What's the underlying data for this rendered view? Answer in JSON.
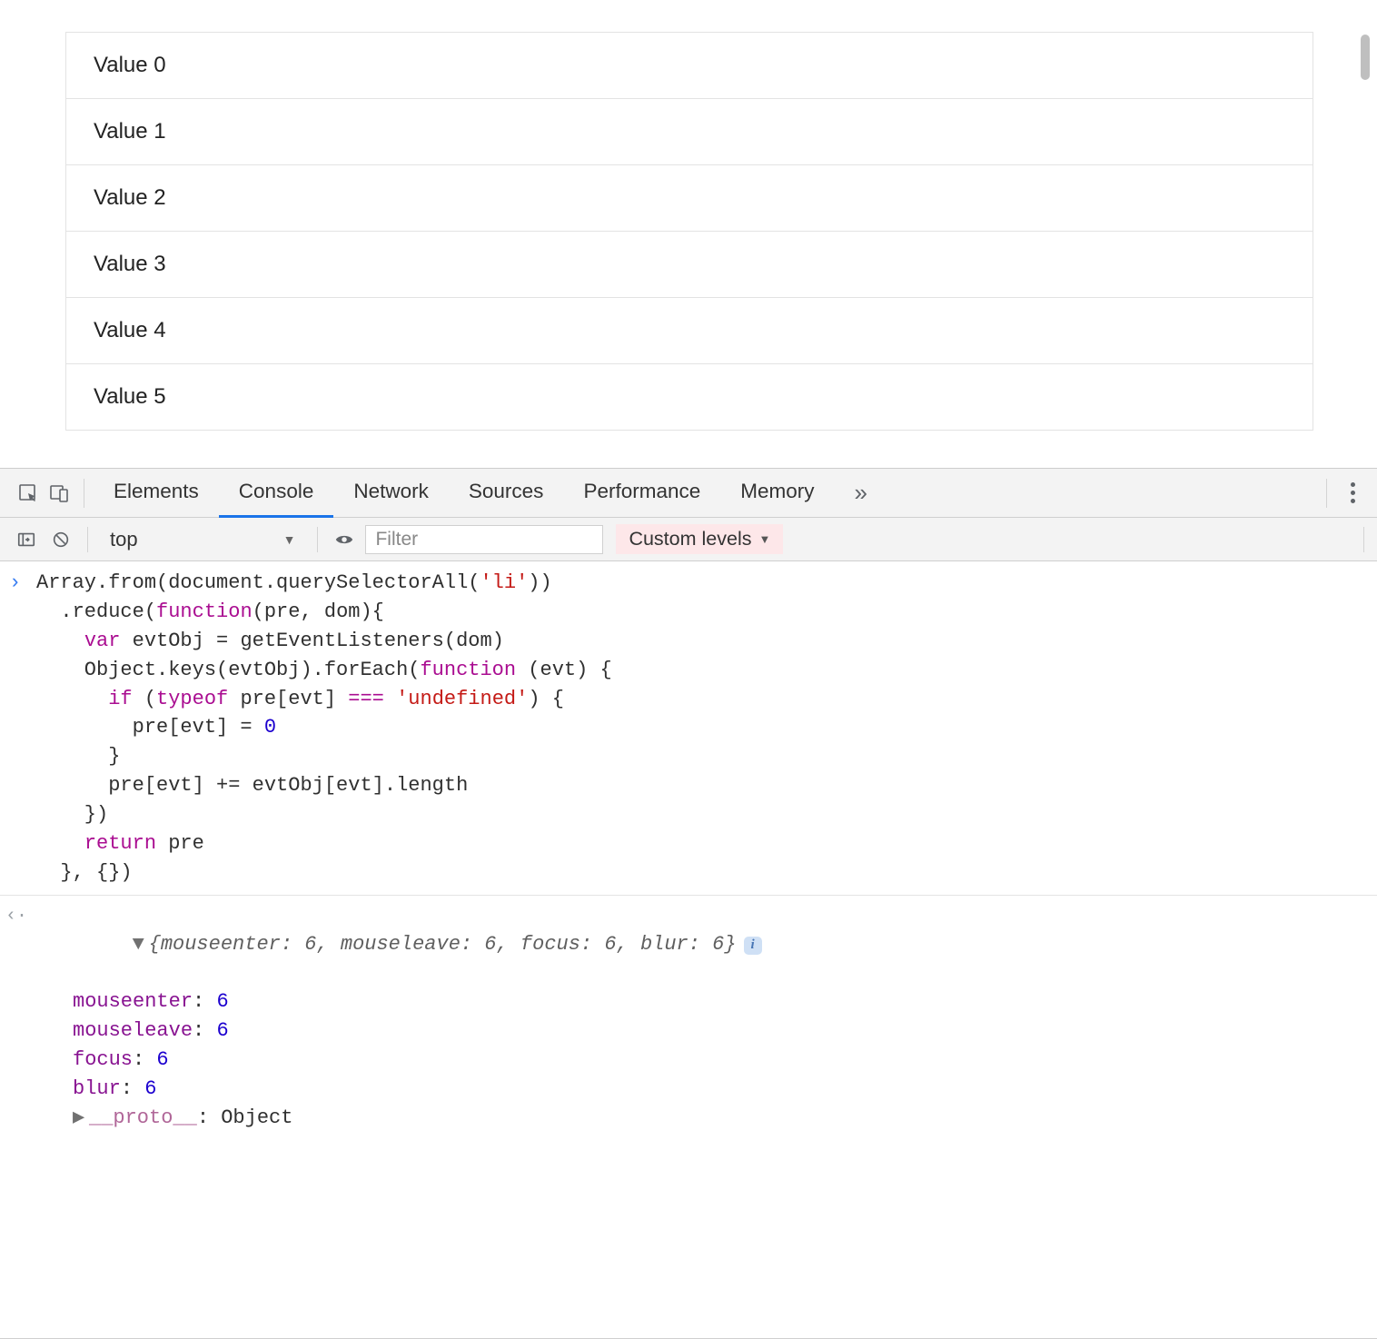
{
  "page": {
    "list_items": [
      "Value 0",
      "Value 1",
      "Value 2",
      "Value 3",
      "Value 4",
      "Value 5"
    ]
  },
  "devtools": {
    "tabs": {
      "elements": "Elements",
      "console": "Console",
      "network": "Network",
      "sources": "Sources",
      "performance": "Performance",
      "memory": "Memory"
    },
    "more_glyph": "»",
    "toolbar": {
      "context": "top",
      "filter_placeholder": "Filter",
      "levels_label": "Custom levels"
    },
    "code": {
      "l1a": "Array.from(document.querySelectorAll(",
      "l1s": "'li'",
      "l1b": "))",
      "l2a": "  .reduce(",
      "l2kw": "function",
      "l2b": "(pre, dom){",
      "l3a": "    ",
      "l3kw": "var",
      "l3b": " evtObj = getEventListeners(dom)",
      "l4a": "    Object.keys(evtObj).forEach(",
      "l4kw": "function",
      "l4b": " (evt) {",
      "l5a": "      ",
      "l5kw": "if",
      "l5b": " (",
      "l5kw2": "typeof",
      "l5c": " pre[evt] ",
      "l5op": "===",
      "l5d": " ",
      "l5s": "'undefined'",
      "l5e": ") {",
      "l6a": "        pre[evt] = ",
      "l6n": "0",
      "l7": "      }",
      "l8": "      pre[evt] += evtObj[evt].length",
      "l9": "    })",
      "l10a": "    ",
      "l10kw": "return",
      "l10b": " pre",
      "l11": "  }, {})"
    },
    "output": {
      "summary_open": "{",
      "summary_pairs": [
        {
          "k": "mouseenter",
          "v": "6"
        },
        {
          "k": "mouseleave",
          "v": "6"
        },
        {
          "k": "focus",
          "v": "6"
        },
        {
          "k": "blur",
          "v": "6"
        }
      ],
      "summary_close": "}",
      "props": [
        {
          "k": "mouseenter",
          "v": "6"
        },
        {
          "k": "mouseleave",
          "v": "6"
        },
        {
          "k": "focus",
          "v": "6"
        },
        {
          "k": "blur",
          "v": "6"
        }
      ],
      "proto_k": "__proto__",
      "proto_v": "Object"
    }
  }
}
